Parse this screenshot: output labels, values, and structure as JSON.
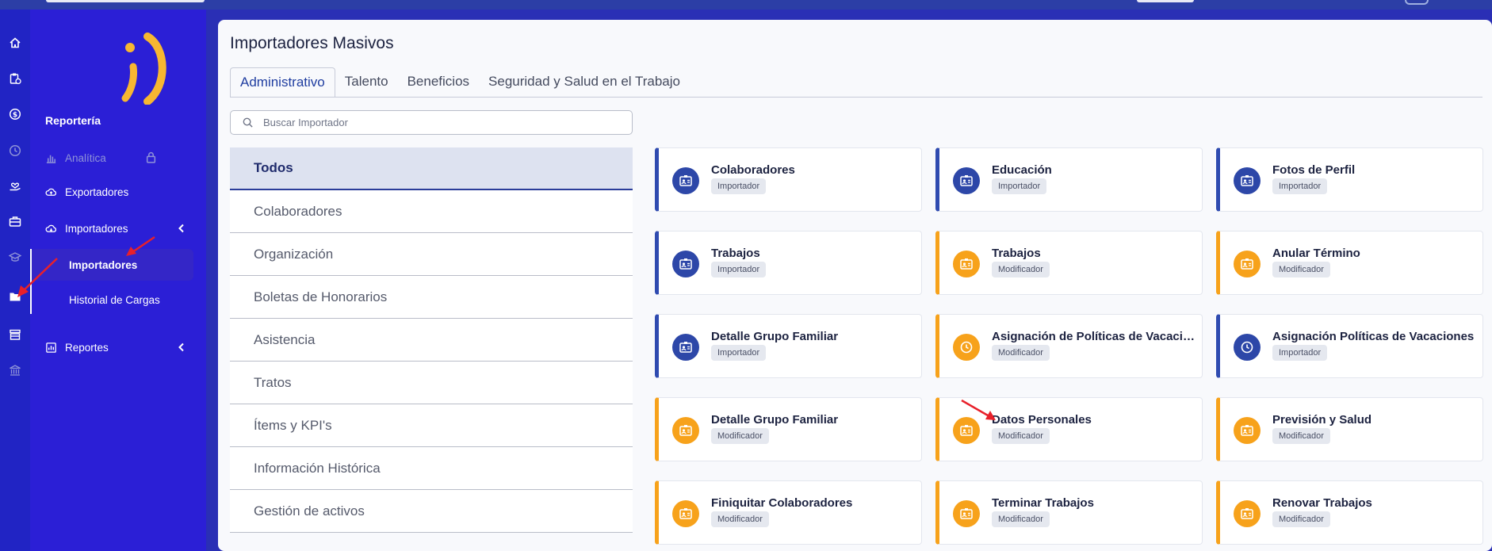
{
  "sidebar": {
    "section_title": "Reportería",
    "items": [
      {
        "label": "Analítica"
      },
      {
        "label": "Exportadores"
      },
      {
        "label": "Importadores"
      },
      {
        "label": "Reportes"
      }
    ],
    "sub_items": [
      {
        "label": "Importadores"
      },
      {
        "label": "Historial de Cargas"
      }
    ]
  },
  "main": {
    "title": "Importadores Masivos",
    "tabs": [
      {
        "label": "Administrativo"
      },
      {
        "label": "Talento"
      },
      {
        "label": "Beneficios"
      },
      {
        "label": "Seguridad y Salud en el Trabajo"
      }
    ],
    "search_placeholder": "Buscar Importador",
    "categories": [
      "Todos",
      "Colaboradores",
      "Organización",
      "Boletas de Honorarios",
      "Asistencia",
      "Tratos",
      "Ítems y KPI's",
      "Información Histórica",
      "Gestión de activos"
    ],
    "tiles": [
      {
        "name": "Colaboradores",
        "badge": "Importador"
      },
      {
        "name": "Educación",
        "badge": "Importador"
      },
      {
        "name": "Fotos de Perfil",
        "badge": "Importador"
      },
      {
        "name": "Trabajos",
        "badge": "Importador"
      },
      {
        "name": "Trabajos",
        "badge": "Modificador"
      },
      {
        "name": "Anular Término",
        "badge": "Modificador"
      },
      {
        "name": "Detalle Grupo Familiar",
        "badge": "Importador"
      },
      {
        "name": "Asignación de Políticas de Vacacio...",
        "badge": "Modificador"
      },
      {
        "name": "Asignación Políticas de Vacaciones",
        "badge": "Importador"
      },
      {
        "name": "Detalle Grupo Familiar",
        "badge": "Modificador"
      },
      {
        "name": "Datos Personales",
        "badge": "Modificador"
      },
      {
        "name": "Previsión y Salud",
        "badge": "Modificador"
      },
      {
        "name": "Finiquitar Colaboradores",
        "badge": "Modificador"
      },
      {
        "name": "Terminar Trabajos",
        "badge": "Modificador"
      },
      {
        "name": "Renovar Trabajos",
        "badge": "Modificador"
      }
    ]
  },
  "colors": {
    "importador": "#2f4bb0",
    "modificador": "#f7a21b",
    "sidebar_bg": "#2b1fd6",
    "logo": "#f7b731"
  }
}
